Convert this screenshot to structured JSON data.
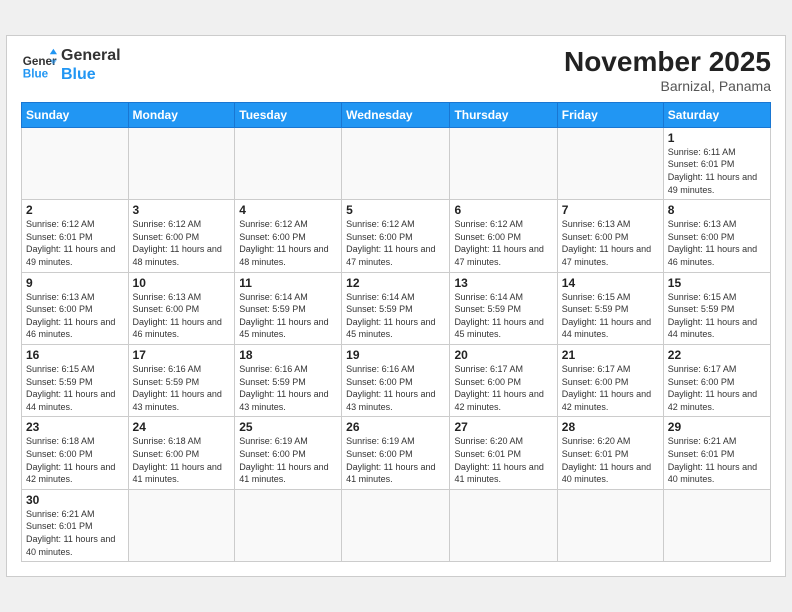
{
  "header": {
    "logo_general": "General",
    "logo_blue": "Blue",
    "month_title": "November 2025",
    "subtitle": "Barnizal, Panama"
  },
  "weekdays": [
    "Sunday",
    "Monday",
    "Tuesday",
    "Wednesday",
    "Thursday",
    "Friday",
    "Saturday"
  ],
  "days": [
    {
      "num": "",
      "sunrise": "",
      "sunset": "",
      "daylight": "",
      "empty": true
    },
    {
      "num": "",
      "sunrise": "",
      "sunset": "",
      "daylight": "",
      "empty": true
    },
    {
      "num": "",
      "sunrise": "",
      "sunset": "",
      "daylight": "",
      "empty": true
    },
    {
      "num": "",
      "sunrise": "",
      "sunset": "",
      "daylight": "",
      "empty": true
    },
    {
      "num": "",
      "sunrise": "",
      "sunset": "",
      "daylight": "",
      "empty": true
    },
    {
      "num": "",
      "sunrise": "",
      "sunset": "",
      "daylight": "",
      "empty": true
    },
    {
      "num": "1",
      "sunrise": "Sunrise: 6:11 AM",
      "sunset": "Sunset: 6:01 PM",
      "daylight": "Daylight: 11 hours and 49 minutes.",
      "empty": false
    },
    {
      "num": "2",
      "sunrise": "Sunrise: 6:12 AM",
      "sunset": "Sunset: 6:01 PM",
      "daylight": "Daylight: 11 hours and 49 minutes.",
      "empty": false
    },
    {
      "num": "3",
      "sunrise": "Sunrise: 6:12 AM",
      "sunset": "Sunset: 6:00 PM",
      "daylight": "Daylight: 11 hours and 48 minutes.",
      "empty": false
    },
    {
      "num": "4",
      "sunrise": "Sunrise: 6:12 AM",
      "sunset": "Sunset: 6:00 PM",
      "daylight": "Daylight: 11 hours and 48 minutes.",
      "empty": false
    },
    {
      "num": "5",
      "sunrise": "Sunrise: 6:12 AM",
      "sunset": "Sunset: 6:00 PM",
      "daylight": "Daylight: 11 hours and 47 minutes.",
      "empty": false
    },
    {
      "num": "6",
      "sunrise": "Sunrise: 6:12 AM",
      "sunset": "Sunset: 6:00 PM",
      "daylight": "Daylight: 11 hours and 47 minutes.",
      "empty": false
    },
    {
      "num": "7",
      "sunrise": "Sunrise: 6:13 AM",
      "sunset": "Sunset: 6:00 PM",
      "daylight": "Daylight: 11 hours and 47 minutes.",
      "empty": false
    },
    {
      "num": "8",
      "sunrise": "Sunrise: 6:13 AM",
      "sunset": "Sunset: 6:00 PM",
      "daylight": "Daylight: 11 hours and 46 minutes.",
      "empty": false
    },
    {
      "num": "9",
      "sunrise": "Sunrise: 6:13 AM",
      "sunset": "Sunset: 6:00 PM",
      "daylight": "Daylight: 11 hours and 46 minutes.",
      "empty": false
    },
    {
      "num": "10",
      "sunrise": "Sunrise: 6:13 AM",
      "sunset": "Sunset: 6:00 PM",
      "daylight": "Daylight: 11 hours and 46 minutes.",
      "empty": false
    },
    {
      "num": "11",
      "sunrise": "Sunrise: 6:14 AM",
      "sunset": "Sunset: 5:59 PM",
      "daylight": "Daylight: 11 hours and 45 minutes.",
      "empty": false
    },
    {
      "num": "12",
      "sunrise": "Sunrise: 6:14 AM",
      "sunset": "Sunset: 5:59 PM",
      "daylight": "Daylight: 11 hours and 45 minutes.",
      "empty": false
    },
    {
      "num": "13",
      "sunrise": "Sunrise: 6:14 AM",
      "sunset": "Sunset: 5:59 PM",
      "daylight": "Daylight: 11 hours and 45 minutes.",
      "empty": false
    },
    {
      "num": "14",
      "sunrise": "Sunrise: 6:15 AM",
      "sunset": "Sunset: 5:59 PM",
      "daylight": "Daylight: 11 hours and 44 minutes.",
      "empty": false
    },
    {
      "num": "15",
      "sunrise": "Sunrise: 6:15 AM",
      "sunset": "Sunset: 5:59 PM",
      "daylight": "Daylight: 11 hours and 44 minutes.",
      "empty": false
    },
    {
      "num": "16",
      "sunrise": "Sunrise: 6:15 AM",
      "sunset": "Sunset: 5:59 PM",
      "daylight": "Daylight: 11 hours and 44 minutes.",
      "empty": false
    },
    {
      "num": "17",
      "sunrise": "Sunrise: 6:16 AM",
      "sunset": "Sunset: 5:59 PM",
      "daylight": "Daylight: 11 hours and 43 minutes.",
      "empty": false
    },
    {
      "num": "18",
      "sunrise": "Sunrise: 6:16 AM",
      "sunset": "Sunset: 5:59 PM",
      "daylight": "Daylight: 11 hours and 43 minutes.",
      "empty": false
    },
    {
      "num": "19",
      "sunrise": "Sunrise: 6:16 AM",
      "sunset": "Sunset: 6:00 PM",
      "daylight": "Daylight: 11 hours and 43 minutes.",
      "empty": false
    },
    {
      "num": "20",
      "sunrise": "Sunrise: 6:17 AM",
      "sunset": "Sunset: 6:00 PM",
      "daylight": "Daylight: 11 hours and 42 minutes.",
      "empty": false
    },
    {
      "num": "21",
      "sunrise": "Sunrise: 6:17 AM",
      "sunset": "Sunset: 6:00 PM",
      "daylight": "Daylight: 11 hours and 42 minutes.",
      "empty": false
    },
    {
      "num": "22",
      "sunrise": "Sunrise: 6:17 AM",
      "sunset": "Sunset: 6:00 PM",
      "daylight": "Daylight: 11 hours and 42 minutes.",
      "empty": false
    },
    {
      "num": "23",
      "sunrise": "Sunrise: 6:18 AM",
      "sunset": "Sunset: 6:00 PM",
      "daylight": "Daylight: 11 hours and 42 minutes.",
      "empty": false
    },
    {
      "num": "24",
      "sunrise": "Sunrise: 6:18 AM",
      "sunset": "Sunset: 6:00 PM",
      "daylight": "Daylight: 11 hours and 41 minutes.",
      "empty": false
    },
    {
      "num": "25",
      "sunrise": "Sunrise: 6:19 AM",
      "sunset": "Sunset: 6:00 PM",
      "daylight": "Daylight: 11 hours and 41 minutes.",
      "empty": false
    },
    {
      "num": "26",
      "sunrise": "Sunrise: 6:19 AM",
      "sunset": "Sunset: 6:00 PM",
      "daylight": "Daylight: 11 hours and 41 minutes.",
      "empty": false
    },
    {
      "num": "27",
      "sunrise": "Sunrise: 6:20 AM",
      "sunset": "Sunset: 6:01 PM",
      "daylight": "Daylight: 11 hours and 41 minutes.",
      "empty": false
    },
    {
      "num": "28",
      "sunrise": "Sunrise: 6:20 AM",
      "sunset": "Sunset: 6:01 PM",
      "daylight": "Daylight: 11 hours and 40 minutes.",
      "empty": false
    },
    {
      "num": "29",
      "sunrise": "Sunrise: 6:21 AM",
      "sunset": "Sunset: 6:01 PM",
      "daylight": "Daylight: 11 hours and 40 minutes.",
      "empty": false
    },
    {
      "num": "30",
      "sunrise": "Sunrise: 6:21 AM",
      "sunset": "Sunset: 6:01 PM",
      "daylight": "Daylight: 11 hours and 40 minutes.",
      "empty": false
    }
  ]
}
